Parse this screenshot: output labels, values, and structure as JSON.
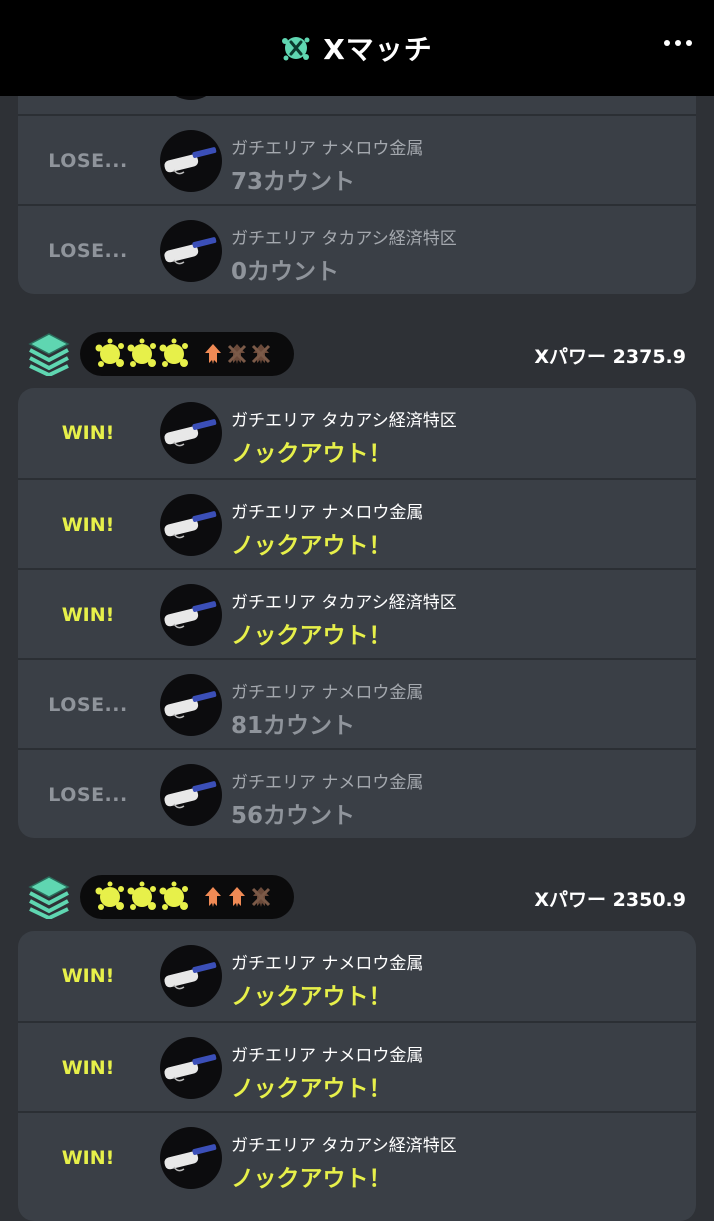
{
  "header": {
    "title": "Xマッチ",
    "icon": "x-match-icon",
    "menu_icon": "more-dots-icon"
  },
  "colors": {
    "win": "#e7f04a",
    "lose": "#8f949b",
    "squid_orange": "#f08a55",
    "rank_teal": "#5fd6b1"
  },
  "groups": [
    {
      "xpower": "",
      "rows": [
        {
          "result": "",
          "stage": "",
          "outcome": ""
        },
        {
          "result": "LOSE...",
          "stage": "ガチエリア ナメロウ金属",
          "outcome": "73カウント"
        },
        {
          "result": "LOSE...",
          "stage": "ガチエリア タカアシ経済特区",
          "outcome": "0カウント"
        }
      ]
    },
    {
      "xpower": "Xパワー 2375.9",
      "wins_in_set": 3,
      "losses_in_set": 2,
      "rows": [
        {
          "result": "WIN!",
          "stage": "ガチエリア タカアシ経済特区",
          "outcome": "ノックアウト！"
        },
        {
          "result": "WIN!",
          "stage": "ガチエリア ナメロウ金属",
          "outcome": "ノックアウト！"
        },
        {
          "result": "WIN!",
          "stage": "ガチエリア タカアシ経済特区",
          "outcome": "ノックアウト！"
        },
        {
          "result": "LOSE...",
          "stage": "ガチエリア ナメロウ金属",
          "outcome": "81カウント"
        },
        {
          "result": "LOSE...",
          "stage": "ガチエリア ナメロウ金属",
          "outcome": "56カウント"
        }
      ]
    },
    {
      "xpower": "Xパワー 2350.9",
      "wins_in_set": 3,
      "losses_in_set": 1,
      "rows": [
        {
          "result": "WIN!",
          "stage": "ガチエリア ナメロウ金属",
          "outcome": "ノックアウト！"
        },
        {
          "result": "WIN!",
          "stage": "ガチエリア ナメロウ金属",
          "outcome": "ノックアウト！"
        },
        {
          "result": "WIN!",
          "stage": "ガチエリア タカアシ経済特区",
          "outcome": "ノックアウト！"
        }
      ]
    }
  ]
}
